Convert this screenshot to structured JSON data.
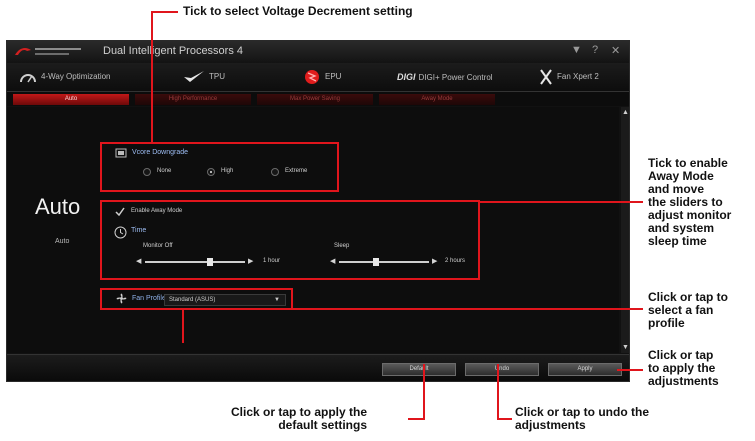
{
  "callouts": {
    "voltage": "Tick to select Voltage Decrement setting",
    "away_mode": [
      "Tick to enable",
      "Away Mode",
      "and move",
      "the sliders to",
      "adjust monitor",
      "and system",
      "sleep time"
    ],
    "fan_profile": [
      "Click or tap to",
      "select a fan",
      "profile"
    ],
    "apply": [
      "Click or tap",
      "to apply the",
      "adjustments"
    ],
    "default": [
      "Click or tap to apply the",
      "default settings"
    ],
    "undo": [
      "Click or tap to undo the",
      "adjustments"
    ]
  },
  "app": {
    "title": "Dual Intelligent Processors 4",
    "window_buttons": [
      "▼",
      "?",
      "✕"
    ],
    "modules": [
      {
        "label": "4-Way Optimization",
        "icon": "speedometer-icon"
      },
      {
        "label": "TPU",
        "icon": "checkmark-wing-icon"
      },
      {
        "label": "EPU",
        "icon": "epu-icon"
      },
      {
        "label": "DIGI+ Power Control",
        "icon": "digi-logo-icon",
        "prefix": "DIGI"
      },
      {
        "label": "Fan Xpert 2",
        "icon": "fan-x-icon"
      }
    ],
    "subtabs": [
      "Auto",
      "High Performance",
      "Max Power Saving",
      "Away Mode"
    ],
    "active_subtab": 0,
    "mode_title": "Auto",
    "mode_caption": "Auto",
    "vcore": {
      "title": "Vcore Downgrade",
      "options": [
        "None",
        "High",
        "Extreme"
      ],
      "selected": 1
    },
    "away": {
      "enable_label": "Enable Away Mode",
      "time_label": "Time",
      "monitor_label": "Monitor Off",
      "monitor_value": "1 hour",
      "sleep_label": "Sleep",
      "sleep_value": "2 hours"
    },
    "fan": {
      "label": "Fan Profile",
      "selected": "Standard (ASUS)"
    },
    "buttons": {
      "default": "Default",
      "undo": "Undo",
      "apply": "Apply"
    }
  }
}
